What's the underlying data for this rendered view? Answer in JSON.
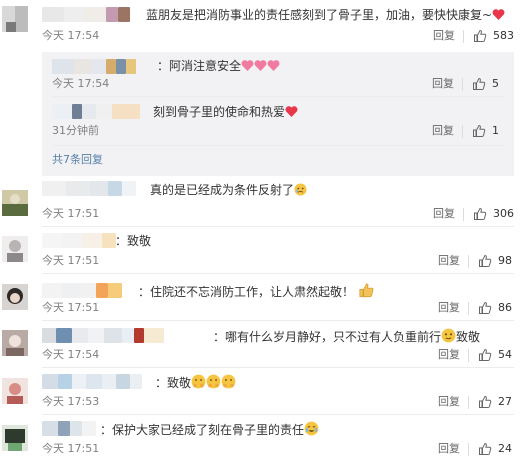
{
  "comments": [
    {
      "text": "蓝朋友是把消防事业的责任感刻到了骨子里，加油，要快快康复~",
      "time": "今天 17:54",
      "reply": "回复",
      "likes": "583"
    },
    {
      "text": "真的是已经成为条件反射了",
      "time": "今天 17:51",
      "reply": "回复",
      "likes": "306"
    },
    {
      "text": "：致敬",
      "time": "今天 17:51",
      "reply": "回复",
      "likes": "98"
    },
    {
      "text": "：住院还不忘消防工作，让人肃然起敬！",
      "time": "今天 17:51",
      "reply": "回复",
      "likes": "86"
    },
    {
      "text": "：哪有什么岁月静好，只不过有人负重前行",
      "suffix": "致敬",
      "time": "今天 17:54",
      "reply": "回复",
      "likes": "54"
    },
    {
      "text": "：致敬",
      "time": "今天 17:53",
      "reply": "回复",
      "likes": "27"
    },
    {
      "text": "：保护大家已经成了刻在骨子里的责任",
      "time": "今天 17:51",
      "reply": "回复",
      "likes": "24"
    }
  ],
  "replies": [
    {
      "text": "：阿消注意安全",
      "time": "今天 17:54",
      "reply": "回复",
      "likes": "5"
    },
    {
      "text": "刻到骨子里的使命和热爱",
      "time": "31分钟前",
      "reply": "回复",
      "likes": "1"
    }
  ],
  "more_replies": "共7条回复",
  "colors": {
    "accent_link": "#5780a8",
    "heart": "#e8374a",
    "panel_bg": "#f2f2f5"
  },
  "icons": {
    "like": "thumbs-up-icon",
    "heart": "heart-emoji-icon",
    "face": "face-emoji-icon"
  }
}
